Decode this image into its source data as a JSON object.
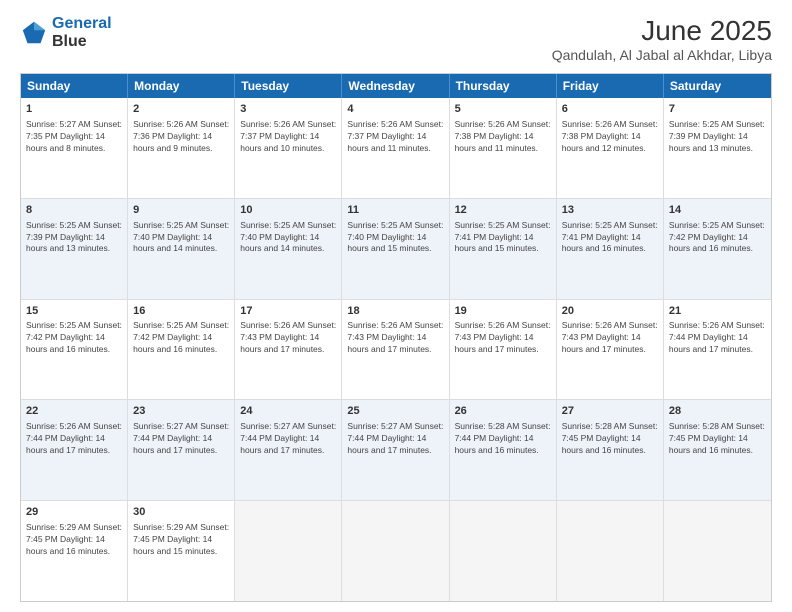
{
  "header": {
    "logo_line1": "General",
    "logo_line2": "Blue",
    "title": "June 2025",
    "subtitle": "Qandulah, Al Jabal al Akhdar, Libya"
  },
  "weekdays": [
    "Sunday",
    "Monday",
    "Tuesday",
    "Wednesday",
    "Thursday",
    "Friday",
    "Saturday"
  ],
  "rows": [
    {
      "alt": false,
      "cells": [
        {
          "day": "1",
          "info": "Sunrise: 5:27 AM\nSunset: 7:35 PM\nDaylight: 14 hours\nand 8 minutes."
        },
        {
          "day": "2",
          "info": "Sunrise: 5:26 AM\nSunset: 7:36 PM\nDaylight: 14 hours\nand 9 minutes."
        },
        {
          "day": "3",
          "info": "Sunrise: 5:26 AM\nSunset: 7:37 PM\nDaylight: 14 hours\nand 10 minutes."
        },
        {
          "day": "4",
          "info": "Sunrise: 5:26 AM\nSunset: 7:37 PM\nDaylight: 14 hours\nand 11 minutes."
        },
        {
          "day": "5",
          "info": "Sunrise: 5:26 AM\nSunset: 7:38 PM\nDaylight: 14 hours\nand 11 minutes."
        },
        {
          "day": "6",
          "info": "Sunrise: 5:26 AM\nSunset: 7:38 PM\nDaylight: 14 hours\nand 12 minutes."
        },
        {
          "day": "7",
          "info": "Sunrise: 5:25 AM\nSunset: 7:39 PM\nDaylight: 14 hours\nand 13 minutes."
        }
      ]
    },
    {
      "alt": true,
      "cells": [
        {
          "day": "8",
          "info": "Sunrise: 5:25 AM\nSunset: 7:39 PM\nDaylight: 14 hours\nand 13 minutes."
        },
        {
          "day": "9",
          "info": "Sunrise: 5:25 AM\nSunset: 7:40 PM\nDaylight: 14 hours\nand 14 minutes."
        },
        {
          "day": "10",
          "info": "Sunrise: 5:25 AM\nSunset: 7:40 PM\nDaylight: 14 hours\nand 14 minutes."
        },
        {
          "day": "11",
          "info": "Sunrise: 5:25 AM\nSunset: 7:40 PM\nDaylight: 14 hours\nand 15 minutes."
        },
        {
          "day": "12",
          "info": "Sunrise: 5:25 AM\nSunset: 7:41 PM\nDaylight: 14 hours\nand 15 minutes."
        },
        {
          "day": "13",
          "info": "Sunrise: 5:25 AM\nSunset: 7:41 PM\nDaylight: 14 hours\nand 16 minutes."
        },
        {
          "day": "14",
          "info": "Sunrise: 5:25 AM\nSunset: 7:42 PM\nDaylight: 14 hours\nand 16 minutes."
        }
      ]
    },
    {
      "alt": false,
      "cells": [
        {
          "day": "15",
          "info": "Sunrise: 5:25 AM\nSunset: 7:42 PM\nDaylight: 14 hours\nand 16 minutes."
        },
        {
          "day": "16",
          "info": "Sunrise: 5:25 AM\nSunset: 7:42 PM\nDaylight: 14 hours\nand 16 minutes."
        },
        {
          "day": "17",
          "info": "Sunrise: 5:26 AM\nSunset: 7:43 PM\nDaylight: 14 hours\nand 17 minutes."
        },
        {
          "day": "18",
          "info": "Sunrise: 5:26 AM\nSunset: 7:43 PM\nDaylight: 14 hours\nand 17 minutes."
        },
        {
          "day": "19",
          "info": "Sunrise: 5:26 AM\nSunset: 7:43 PM\nDaylight: 14 hours\nand 17 minutes."
        },
        {
          "day": "20",
          "info": "Sunrise: 5:26 AM\nSunset: 7:43 PM\nDaylight: 14 hours\nand 17 minutes."
        },
        {
          "day": "21",
          "info": "Sunrise: 5:26 AM\nSunset: 7:44 PM\nDaylight: 14 hours\nand 17 minutes."
        }
      ]
    },
    {
      "alt": true,
      "cells": [
        {
          "day": "22",
          "info": "Sunrise: 5:26 AM\nSunset: 7:44 PM\nDaylight: 14 hours\nand 17 minutes."
        },
        {
          "day": "23",
          "info": "Sunrise: 5:27 AM\nSunset: 7:44 PM\nDaylight: 14 hours\nand 17 minutes."
        },
        {
          "day": "24",
          "info": "Sunrise: 5:27 AM\nSunset: 7:44 PM\nDaylight: 14 hours\nand 17 minutes."
        },
        {
          "day": "25",
          "info": "Sunrise: 5:27 AM\nSunset: 7:44 PM\nDaylight: 14 hours\nand 17 minutes."
        },
        {
          "day": "26",
          "info": "Sunrise: 5:28 AM\nSunset: 7:44 PM\nDaylight: 14 hours\nand 16 minutes."
        },
        {
          "day": "27",
          "info": "Sunrise: 5:28 AM\nSunset: 7:45 PM\nDaylight: 14 hours\nand 16 minutes."
        },
        {
          "day": "28",
          "info": "Sunrise: 5:28 AM\nSunset: 7:45 PM\nDaylight: 14 hours\nand 16 minutes."
        }
      ]
    },
    {
      "alt": false,
      "cells": [
        {
          "day": "29",
          "info": "Sunrise: 5:29 AM\nSunset: 7:45 PM\nDaylight: 14 hours\nand 16 minutes."
        },
        {
          "day": "30",
          "info": "Sunrise: 5:29 AM\nSunset: 7:45 PM\nDaylight: 14 hours\nand 15 minutes."
        },
        {
          "day": "",
          "info": ""
        },
        {
          "day": "",
          "info": ""
        },
        {
          "day": "",
          "info": ""
        },
        {
          "day": "",
          "info": ""
        },
        {
          "day": "",
          "info": ""
        }
      ]
    }
  ]
}
